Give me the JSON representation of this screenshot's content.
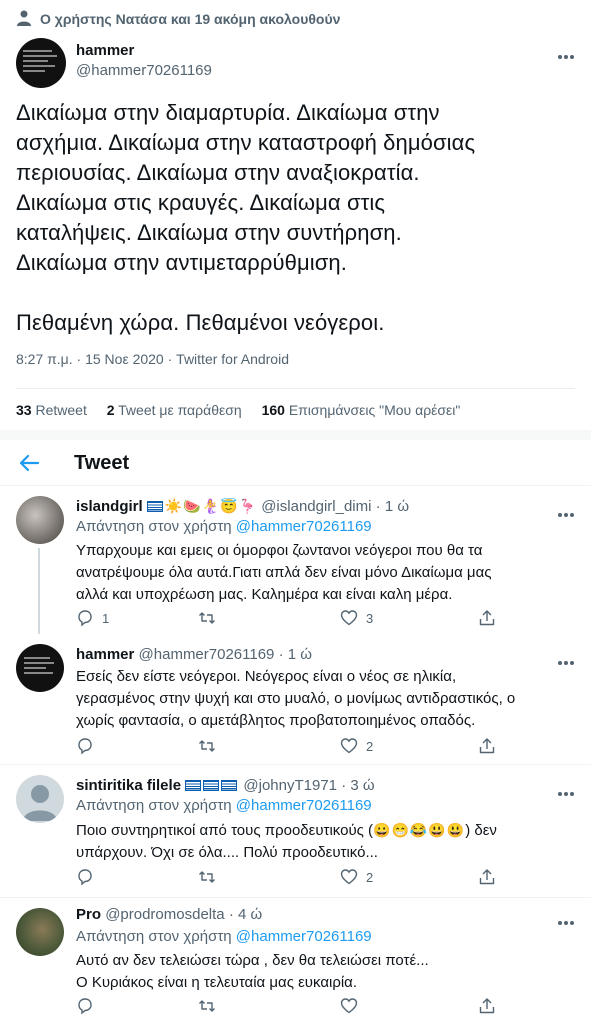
{
  "social_context": "Ο χρήστης Νατάσα και 19 ακόμη ακολουθούν",
  "main_tweet": {
    "name": "hammer",
    "handle": "@hammer70261169",
    "text": "Δικαίωμα στην διαμαρτυρία. Δικαίωμα στην\nασχήμια. Δικαίωμα στην καταστροφή δημόσιας\nπεριουσίας. Δικαίωμα στην αναξιοκρατία.\nΔικαίωμα στις κραυγές. Δικαίωμα στις\nκαταλήψεις. Δικαίωμα στην συντήρηση.\nΔικαίωμα στην αντιμεταρρύθμιση.\n\nΠεθαμένη χώρα. Πεθαμένοι νεόγεροι.",
    "meta": "8:27 π.μ. · 15 Νοε 2020 · Twitter for Android",
    "stats": {
      "retweets_count": "33",
      "retweets_label": "Retweet",
      "quotes_count": "2",
      "quotes_label": "Tweet με παράθεση",
      "likes_count": "160",
      "likes_label": "Επισημάνσεις \"Μου αρέσει\""
    }
  },
  "header": {
    "title": "Tweet"
  },
  "replies": [
    {
      "name": "islandgirl",
      "name_emojis": "☀️🍉🧜‍♀️😇🦩",
      "handle": "@islandgirl_dimi",
      "time": "· 1 ώ",
      "replying_prefix": "Απάντηση στον χρήστη",
      "replying_to": "@hammer70261169",
      "text": "Υπαρχουμε και εμεις οι όμορφοι ζωντανοι νεόγεροι που θα τα\nανατρέψουμε όλα αυτά.Γιατι απλά δεν είναι μόνο Δικαίωμα μας\nαλλά και υποχρέωση μας. Καλημέρα και είναι καλη μέρα.",
      "reply_count": "1",
      "retweet_count": "",
      "like_count": "3"
    },
    {
      "name": "hammer",
      "handle": "@hammer70261169",
      "time": "· 1 ώ",
      "text": "Εσείς δεν είστε νεόγεροι. Νεόγερος είναι ο νέος σε ηλικία,\nγερασμένος στην ψυχή και στο μυαλό, ο μονίμως αντιδραστικός, ο\nχωρίς φαντασία, ο αμετάβλητος προβατοποιημένος οπαδός.",
      "reply_count": "",
      "retweet_count": "",
      "like_count": "2"
    },
    {
      "name": "sintiritika filele",
      "handle": "@johnyT1971",
      "time": "· 3 ώ",
      "replying_prefix": "Απάντηση στον χρήστη",
      "replying_to": "@hammer70261169",
      "text_before": "Ποιο συντηρητικοί από τους προοδευτικούς (",
      "text_emojis": "😀😁😂😃😃",
      "text_after": ") δεν\nυπάρχουν. Όχι σε όλα.... Πολύ προοδευτικό...",
      "reply_count": "",
      "retweet_count": "",
      "like_count": "2"
    },
    {
      "name": "Pro",
      "handle": "@prodromosdelta",
      "time": "· 4 ώ",
      "replying_prefix": "Απάντηση στον χρήστη",
      "replying_to": "@hammer70261169",
      "text": "Αυτό αν δεν τελειώσει τώρα , δεν θα τελειώσει ποτέ...\nΟ Κυριάκος είναι η τελευταία μας ευκαιρία.",
      "reply_count": "",
      "retweet_count": "",
      "like_count": ""
    }
  ],
  "colors": {
    "accent": "#1d9bf0",
    "muted": "#536471",
    "text": "#0f1419"
  }
}
